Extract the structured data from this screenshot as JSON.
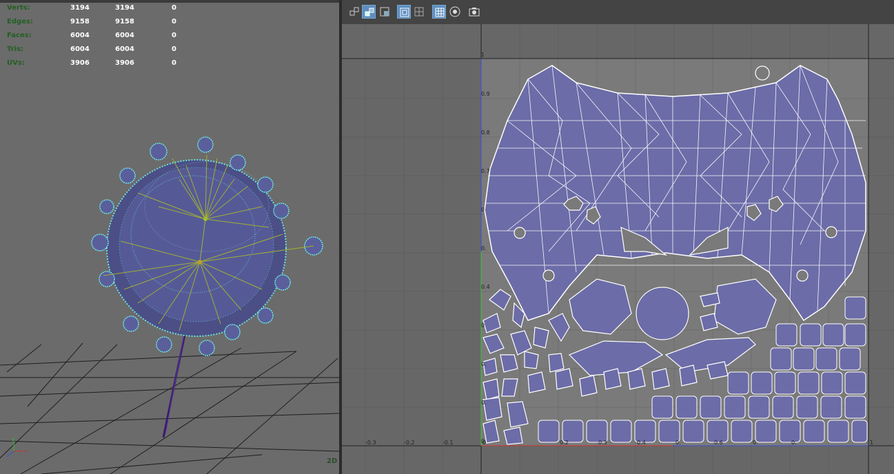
{
  "hud": {
    "rows": [
      {
        "label": "Verts:",
        "v1": "3194",
        "v2": "3194",
        "v3": "0"
      },
      {
        "label": "Edges:",
        "v1": "9158",
        "v2": "9158",
        "v3": "0"
      },
      {
        "label": "Faces:",
        "v1": "6004",
        "v2": "6004",
        "v3": "0"
      },
      {
        "label": "Tris:",
        "v1": "6004",
        "v2": "6004",
        "v3": "0"
      },
      {
        "label": "UVs:",
        "v1": "3906",
        "v2": "3906",
        "v3": "0"
      }
    ]
  },
  "viewport": {
    "corner_label": "2D",
    "axis_labels": {
      "x": "x",
      "y": "y",
      "z": "z"
    }
  },
  "uv_editor": {
    "toolbar": [
      {
        "name": "uv-shell-icon",
        "active": false
      },
      {
        "name": "uv-select-icon",
        "active": true
      },
      {
        "name": "uv-shade-icon",
        "active": false
      },
      {
        "name": "uv-frame-icon",
        "active": true
      },
      {
        "name": "uv-pixel-snap-icon",
        "active": false
      },
      {
        "name": "uv-grid-icon",
        "active": true
      },
      {
        "name": "uv-checker-icon",
        "active": false
      },
      {
        "name": "uv-snapshot-icon",
        "active": false
      }
    ],
    "vertical_ticks": [
      "1",
      "0.9",
      "0.8",
      "0.7",
      "0",
      "0.",
      "0.4",
      "0",
      "0.",
      "0.",
      "0"
    ],
    "horizontal_ticks": [
      "-0.3",
      "-0.2",
      "-0.1",
      "0",
      "0.2",
      "0.3",
      "0.4",
      "0.",
      "0.6",
      "0.",
      "0.",
      "1"
    ],
    "colors": {
      "uv_fill": "#6c6ca8",
      "wire": "#ffffff",
      "canvas": "#676767"
    }
  }
}
